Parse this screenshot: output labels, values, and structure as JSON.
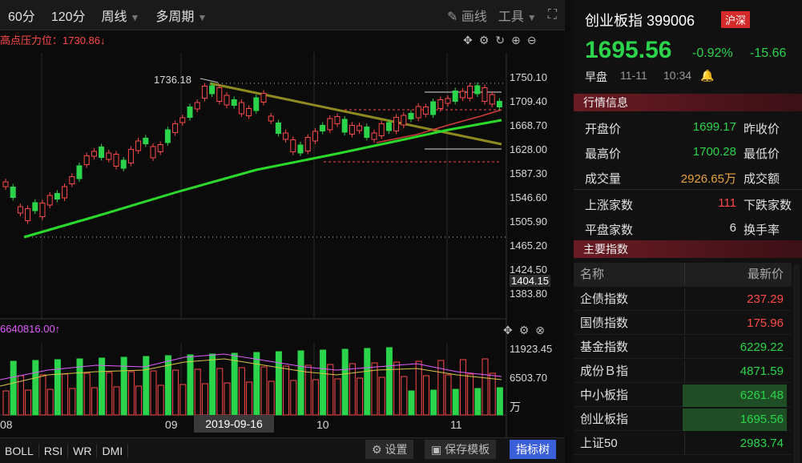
{
  "toolbar": {
    "p60": "60分",
    "p120": "120分",
    "week": "周线",
    "multi": "多周期",
    "draw": "画线",
    "tools": "工具"
  },
  "pressure": "高点压力位：1730.86↓",
  "y_labels": [
    "1750.10",
    "1709.40",
    "1668.70",
    "1628.00",
    "1587.30",
    "1546.60",
    "1505.90",
    "1465.20",
    "1424.50",
    "1404.15",
    "1383.80"
  ],
  "peak_label": "1736.18",
  "vol_label": "6640816.00↑",
  "vol_y_labels": [
    "11923.45",
    "6503.70",
    "万"
  ],
  "x_labels": [
    "08",
    "09",
    "10",
    "11"
  ],
  "date_box": "2019-09-16",
  "indicators": [
    "BOLL",
    "RSI",
    "WR",
    "DMI"
  ],
  "bottom_buttons": {
    "settings": "设置",
    "save": "保存模板",
    "tree": "指标树"
  },
  "side": {
    "name": "创业板指 399006",
    "exchange": "沪深",
    "price": "1695.56",
    "change_pct": "-0.92%",
    "change": "-15.66",
    "session": "早盘",
    "date": "11-11",
    "time": "10:34",
    "section_quote": "行情信息",
    "open_label": "开盘价",
    "open": "1699.17",
    "prev_close_label": "昨收价",
    "high_label": "最高价",
    "high": "1700.28",
    "low_label": "最低价",
    "vol_label": "成交量",
    "vol": "2926.65万",
    "amount_label": "成交额",
    "up_label": "上涨家数",
    "up": "111",
    "down_label": "下跌家数",
    "flat_label": "平盘家数",
    "flat": "6",
    "turnover_label": "换手率",
    "section_index": "主要指数",
    "col_name": "名称",
    "col_price": "最新价",
    "indices": [
      {
        "name": "企债指数",
        "price": "237.29",
        "color": "#ff4a4a"
      },
      {
        "name": "国债指数",
        "price": "175.96",
        "color": "#ff4a4a"
      },
      {
        "name": "基金指数",
        "price": "6229.22",
        "color": "#2bd44a"
      },
      {
        "name": "成份Ｂ指",
        "price": "4871.59",
        "color": "#2bd44a"
      },
      {
        "name": "中小板指",
        "price": "6261.48",
        "color": "#2bd44a"
      },
      {
        "name": "创业板指",
        "price": "1695.56",
        "color": "#2bd44a"
      },
      {
        "name": "上证50",
        "price": "2983.74",
        "color": "#2bd44a"
      }
    ]
  }
}
